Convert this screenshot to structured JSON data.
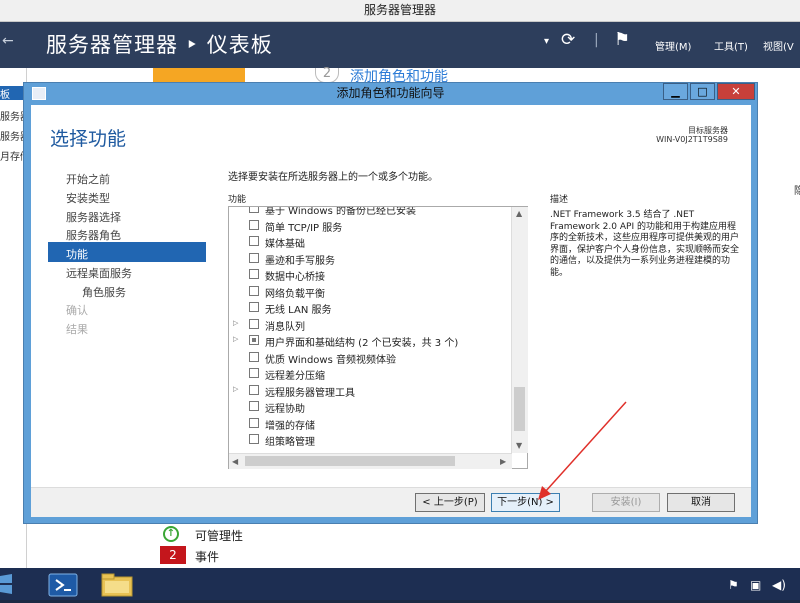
{
  "server_manager": {
    "window_title": "服务器管理器",
    "back_arrow": "←",
    "breadcrumb": "服务器管理器 ‣ 仪表板",
    "refresh_glyph": "⟳",
    "flag_glyph": "⚑",
    "menus": [
      "管理(M)",
      "工具(T)",
      "视图(V"
    ],
    "left_items": [
      "板",
      "服务器",
      "服务器",
      "月存储"
    ],
    "quick_start_number": "2",
    "quick_start_text": "添加角色和功能",
    "manageability": "可管理性",
    "events_count": "2",
    "events_label": "事件",
    "right_edge_char": "隐"
  },
  "dialog": {
    "title": "添加角色和功能向导",
    "controls": {
      "minimize": "▁",
      "maximize": "□",
      "close": "✕"
    },
    "heading": "选择功能",
    "target_label": "目标服务器",
    "target_value": "WIN-V0J2T1T9S89",
    "nav": [
      "开始之前",
      "安装类型",
      "服务器选择",
      "服务器角色",
      "功能",
      "远程桌面服务",
      "角色服务",
      "确认",
      "结果"
    ],
    "instruction": "选择要安装在所选服务器上的一个或多个功能。",
    "features_header": "功能",
    "description_header": "描述",
    "description": ".NET Framework 3.5 结合了 .NET Framework 2.0 API 的功能和用于构建应用程序的全新技术，这些应用程序可提供美观的用户界面，保护客户个人身份信息，实现顺畅而安全的通信，以及提供为一系列业务进程建模的功能。",
    "features": [
      {
        "label": "基于 Windows 的备份已经已安装",
        "expander": false,
        "state": "none"
      },
      {
        "label": "简单 TCP/IP 服务",
        "expander": false,
        "state": "none"
      },
      {
        "label": "媒体基础",
        "expander": false,
        "state": "none"
      },
      {
        "label": "墨迹和手写服务",
        "expander": false,
        "state": "none"
      },
      {
        "label": "数据中心桥接",
        "expander": false,
        "state": "none"
      },
      {
        "label": "网络负载平衡",
        "expander": false,
        "state": "none"
      },
      {
        "label": "无线 LAN 服务",
        "expander": false,
        "state": "none"
      },
      {
        "label": "消息队列",
        "expander": true,
        "state": "none"
      },
      {
        "label": "用户界面和基础结构 (2 个已安装，共 3 个)",
        "expander": true,
        "state": "partial"
      },
      {
        "label": "优质 Windows 音频视频体验",
        "expander": false,
        "state": "none"
      },
      {
        "label": "远程差分压缩",
        "expander": false,
        "state": "none"
      },
      {
        "label": "远程服务器管理工具",
        "expander": true,
        "state": "none"
      },
      {
        "label": "远程协助",
        "expander": false,
        "state": "none"
      },
      {
        "label": "增强的存储",
        "expander": false,
        "state": "none"
      },
      {
        "label": "组策略管理",
        "expander": false,
        "state": "none"
      }
    ],
    "scroll_up": "▲",
    "scroll_down": "▼",
    "scroll_left": "◀",
    "scroll_right": "▶",
    "buttons": {
      "prev": "< 上一步(P)",
      "next": "下一步(N) >",
      "install": "安装(I)",
      "cancel": "取消"
    }
  },
  "colors": {
    "accent": "#2166b2",
    "annotation_arrow": "#e0302a"
  }
}
